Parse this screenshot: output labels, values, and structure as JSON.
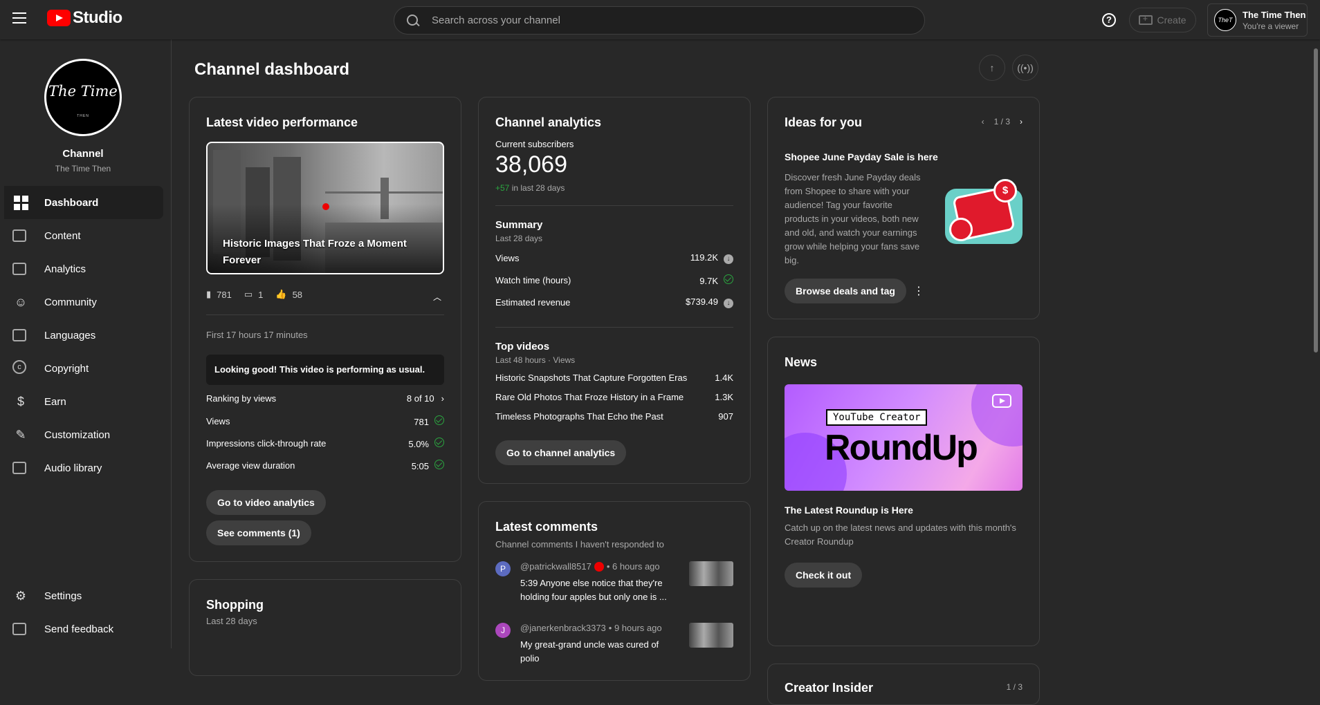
{
  "app": {
    "logo_text": "Studio",
    "brand_color": "#ff0000"
  },
  "header": {
    "search_placeholder": "Search across your channel",
    "help_label": "?",
    "create_label": "Create",
    "account_name": "The Time Then",
    "account_role": "You're a viewer",
    "account_avatar_text": "TheT"
  },
  "sidebar": {
    "channel_title": "Channel",
    "channel_name": "The Time Then",
    "avatar_signature": "The Time",
    "avatar_small": "THEN",
    "items": [
      {
        "label": "Dashboard",
        "icon": "dashboard-icon"
      },
      {
        "label": "Content",
        "icon": "content-icon"
      },
      {
        "label": "Analytics",
        "icon": "analytics-icon"
      },
      {
        "label": "Community",
        "icon": "community-icon"
      },
      {
        "label": "Languages",
        "icon": "languages-icon"
      },
      {
        "label": "Copyright",
        "icon": "copyright-icon"
      },
      {
        "label": "Earn",
        "icon": "earn-icon"
      },
      {
        "label": "Customization",
        "icon": "customization-icon"
      },
      {
        "label": "Audio library",
        "icon": "audio-library-icon"
      }
    ],
    "bottom": [
      {
        "label": "Settings",
        "icon": "settings-icon"
      },
      {
        "label": "Send feedback",
        "icon": "feedback-icon"
      }
    ]
  },
  "page": {
    "title": "Channel dashboard"
  },
  "latest_video": {
    "title": "Latest video performance",
    "video_title": "Historic Images That Froze a Moment Forever",
    "views": "781",
    "comments": "1",
    "likes": "58",
    "period": "First 17 hours 17 minutes",
    "banner": "Looking good! This video is performing as usual.",
    "rows": [
      {
        "label": "Ranking by views",
        "value": "8 of 10"
      },
      {
        "label": "Views",
        "value": "781"
      },
      {
        "label": "Impressions click-through rate",
        "value": "5.0%"
      },
      {
        "label": "Average view duration",
        "value": "5:05"
      }
    ],
    "btn_analytics": "Go to video analytics",
    "btn_comments": "See comments (1)"
  },
  "shopping": {
    "title": "Shopping",
    "subtitle": "Last 28 days"
  },
  "analytics": {
    "title": "Channel analytics",
    "subs_label": "Current subscribers",
    "subs_value": "38,069",
    "subs_delta": "+57",
    "subs_delta_period": "in last 28 days",
    "summary_title": "Summary",
    "summary_period": "Last 28 days",
    "summary_rows": [
      {
        "label": "Views",
        "value": "119.2K"
      },
      {
        "label": "Watch time (hours)",
        "value": "9.7K"
      },
      {
        "label": "Estimated revenue",
        "value": "$739.49"
      }
    ],
    "top_title": "Top videos",
    "top_period": "Last 48 hours · Views",
    "top_rows": [
      {
        "label": "Historic Snapshots That Capture Forgotten Eras",
        "value": "1.4K"
      },
      {
        "label": "Rare Old Photos That Froze History in a Frame",
        "value": "1.3K"
      },
      {
        "label": "Timeless Photographs That Echo the Past",
        "value": "907"
      }
    ],
    "btn": "Go to channel analytics"
  },
  "comments": {
    "title": "Latest comments",
    "subtitle": "Channel comments I haven't responded to",
    "items": [
      {
        "avatar": "P",
        "author": "@patrickwall8517",
        "time": "• 6 hours ago",
        "text": "5:39 Anyone else notice that they're holding four apples but only one is ...",
        "color": "#5c6bc0"
      },
      {
        "avatar": "J",
        "author": "@janerkenbrack3373",
        "time": "• 9 hours ago",
        "text": "My great-grand uncle was cured of polio",
        "color": "#ab47bc"
      }
    ]
  },
  "ideas": {
    "title": "Ideas for you",
    "pager": "1 / 3",
    "heading": "Shopee June Payday Sale is here",
    "body": "Discover fresh June Payday deals from Shopee to share with your audience! Tag your favorite products in your videos, both new and old, and watch your earnings grow while helping your fans save big.",
    "btn": "Browse deals and tag",
    "coin_symbol": "$"
  },
  "news": {
    "title": "News",
    "img_tag": "YouTube Creator",
    "img_big": "RoundUp",
    "heading": "The Latest Roundup is Here",
    "body": "Catch up on the latest news and updates with this month's Creator Roundup",
    "btn": "Check it out"
  },
  "insider": {
    "title": "Creator Insider",
    "pager": "1 / 3"
  }
}
